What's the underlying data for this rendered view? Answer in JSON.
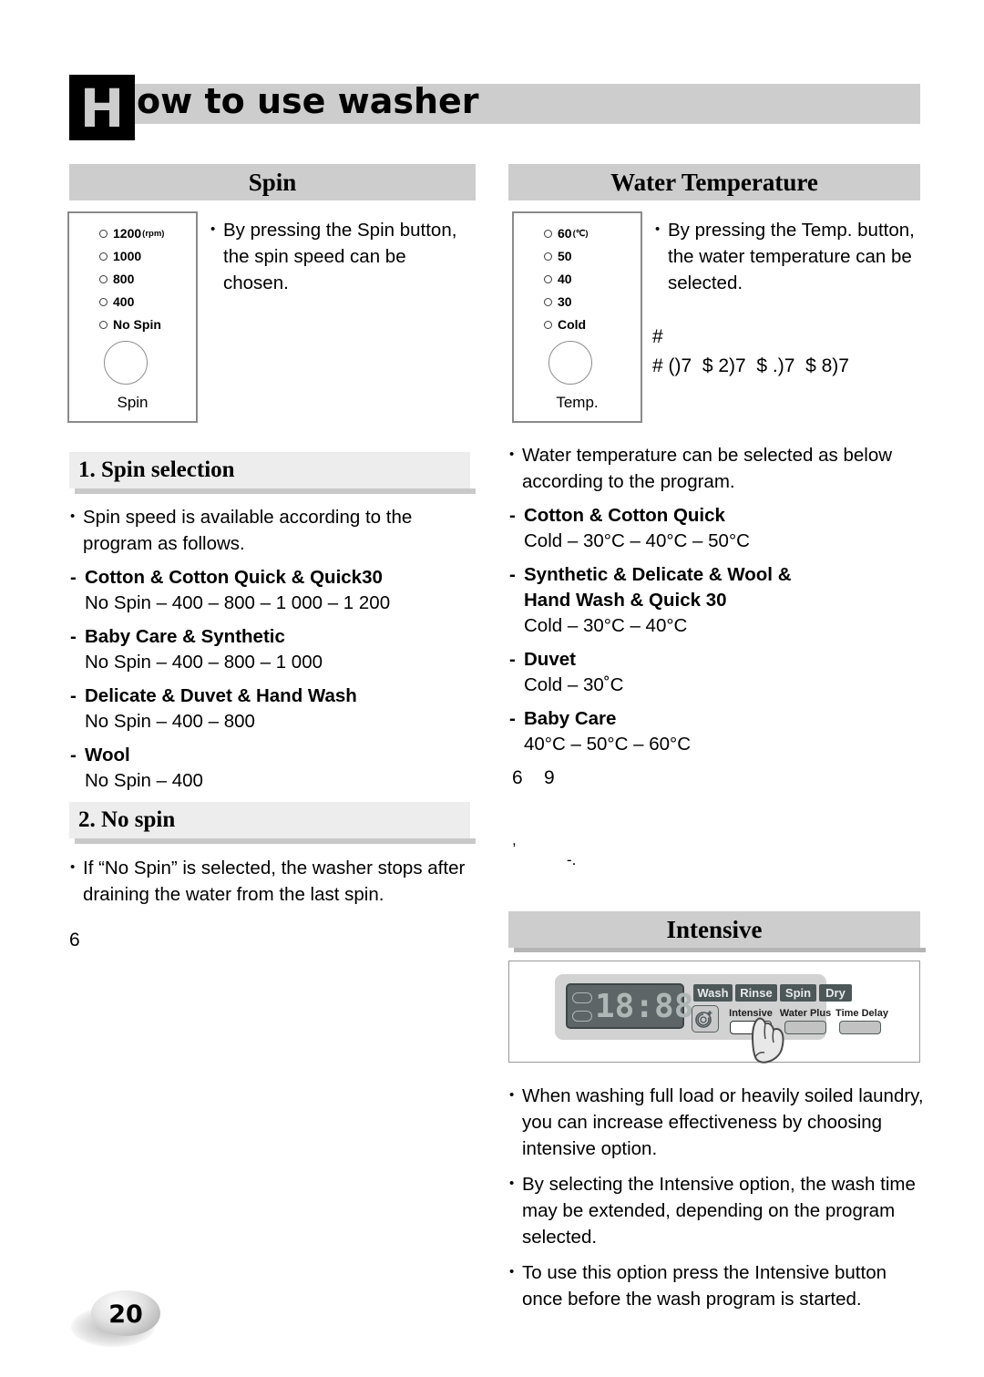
{
  "page": {
    "title_initial": "H",
    "title_rest": "ow to use washer",
    "page_number": "20"
  },
  "spin": {
    "section_title": "Spin",
    "panel": {
      "leds": [
        {
          "label": "1200",
          "unit": "(rpm)"
        },
        {
          "label": "1000",
          "unit": ""
        },
        {
          "label": "800",
          "unit": ""
        },
        {
          "label": "400",
          "unit": ""
        },
        {
          "label": "No Spin",
          "unit": ""
        }
      ],
      "caption": "Spin"
    },
    "intro_bullet": "By pressing the Spin button, the spin speed can be chosen.",
    "subsection_1": {
      "heading": "1. Spin selection",
      "bullet": "Spin speed is available according to the program as follows.",
      "programs": [
        {
          "name": "Cotton & Cotton Quick & Quick30",
          "speeds": "No Spin – 400 – 800 – 1 000 – 1 200"
        },
        {
          "name": "Baby Care & Synthetic",
          "speeds": "No Spin – 400 – 800 – 1 000"
        },
        {
          "name": "Delicate & Duvet & Hand Wash",
          "speeds": "No Spin – 400 – 800"
        },
        {
          "name": "Wool",
          "speeds": "No Spin – 400"
        }
      ]
    },
    "subsection_2": {
      "heading": "2. No spin",
      "bullet": "If “No Spin” is selected, the washer stops after draining the water from the last spin."
    },
    "artifact": "6"
  },
  "water_temperature": {
    "section_title": "Water Temperature",
    "panel": {
      "leds": [
        {
          "label": "60",
          "unit": "(℃)"
        },
        {
          "label": "50",
          "unit": ""
        },
        {
          "label": "40",
          "unit": ""
        },
        {
          "label": "30",
          "unit": ""
        },
        {
          "label": "Cold",
          "unit": ""
        }
      ],
      "caption": "Temp."
    },
    "intro_bullet": "By pressing the Temp. button, the water temperature can be selected.",
    "artifact_line_1": "#",
    "artifact_line_2": "# ()7  $ 2)7  $ .)7  $ 8)7",
    "list_bullet": "Water temperature can be selected as below according to the program.",
    "programs": [
      {
        "name": "Cotton & Cotton Quick",
        "name_cont": "",
        "temps": "Cold – 30°C – 40°C – 50°C"
      },
      {
        "name": "Synthetic & Delicate & Wool &",
        "name_cont": "Hand Wash & Quick 30",
        "temps": "Cold – 30°C – 40°C"
      },
      {
        "name": "Duvet",
        "name_cont": "",
        "temps": "Cold – 30˚C"
      },
      {
        "name": "Baby Care",
        "name_cont": "",
        "temps": "40°C – 50°C – 60°C"
      }
    ],
    "artifact_a": "6    9",
    "artifact_b": ",",
    "artifact_c": "-."
  },
  "intensive": {
    "section_title": "Intensive",
    "diagram": {
      "display_value": "18:88",
      "mode_tabs": [
        "Wash",
        "Rinse",
        "Spin",
        "Dry"
      ],
      "option_labels": [
        "Intensive",
        "Water Plus",
        "Time Delay"
      ],
      "active_option": "Intensive"
    },
    "bullets": [
      "When washing full load or heavily soiled laundry, you can increase effectiveness by choosing intensive option.",
      "By selecting the Intensive option, the wash time may be extended, depending on the program selected.",
      "To use this option press the Intensive button once before the wash program is started."
    ]
  }
}
